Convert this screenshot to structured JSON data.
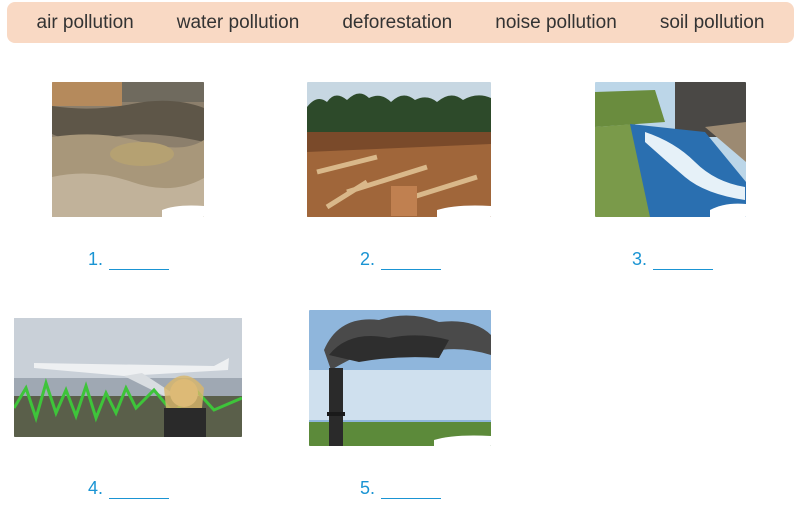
{
  "word_bank": [
    "air pollution",
    "water pollution",
    "deforestation",
    "noise pollution",
    "soil pollution"
  ],
  "items": [
    {
      "number": "1.",
      "image": "eroded-soil-photo"
    },
    {
      "number": "2.",
      "image": "cleared-forest-photo"
    },
    {
      "number": "3.",
      "image": "foamy-river-photo"
    },
    {
      "number": "4.",
      "image": "airplane-noise-photo"
    },
    {
      "number": "5.",
      "image": "smoking-chimney-photo"
    }
  ]
}
